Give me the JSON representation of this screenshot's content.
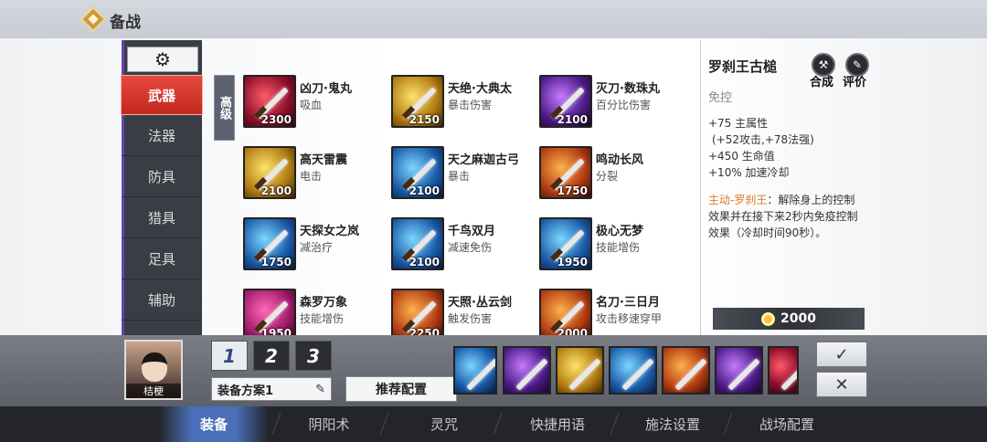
{
  "header": {
    "title": "备战"
  },
  "categories": [
    {
      "label": "武器",
      "active": true
    },
    {
      "label": "法器",
      "active": false
    },
    {
      "label": "防具",
      "active": false
    },
    {
      "label": "猎具",
      "active": false
    },
    {
      "label": "足具",
      "active": false
    },
    {
      "label": "辅助",
      "active": false
    }
  ],
  "tier_tab": "高级",
  "items": [
    {
      "name": "凶刀·鬼丸",
      "desc": "吸血",
      "price": "2300",
      "tone": "red"
    },
    {
      "name": "天绝·大典太",
      "desc": "暴击伤害",
      "price": "2150",
      "tone": "gold"
    },
    {
      "name": "灭刀·数珠丸",
      "desc": "百分比伤害",
      "price": "2100",
      "tone": "purple"
    },
    {
      "name": "高天雷震",
      "desc": "电击",
      "price": "2100",
      "tone": "gold"
    },
    {
      "name": "天之麻迦古弓",
      "desc": "暴击",
      "price": "2100",
      "tone": "blue"
    },
    {
      "name": "鸣动长风",
      "desc": "分裂",
      "price": "1750",
      "tone": "fire"
    },
    {
      "name": "天探女之岚",
      "desc": "减治疗",
      "price": "1750",
      "tone": "blue"
    },
    {
      "name": "千鸟双月",
      "desc": "减速免伤",
      "price": "2100",
      "tone": "blue"
    },
    {
      "name": "极心无梦",
      "desc": "技能增伤",
      "price": "1950",
      "tone": "blue"
    },
    {
      "name": "森罗万象",
      "desc": "技能增伤",
      "price": "1950",
      "tone": "pink"
    },
    {
      "name": "天照·丛云剑",
      "desc": "触发伤害",
      "price": "2250",
      "tone": "fire"
    },
    {
      "name": "名刀·三日月",
      "desc": "攻击移速穿甲",
      "price": "2000",
      "tone": "fire"
    }
  ],
  "detail": {
    "title": "罗刹王古槌",
    "subtitle": "免控",
    "stats": [
      "+75 主属性",
      "(+52攻击,+78法强)",
      "+450 生命值",
      "+10% 加速冷却"
    ],
    "skill_highlight": "主动-罗刹王",
    "skill_text": "：解除身上的控制效果并在接下来2秒内免疫控制效果（冷却时间90秒）。",
    "combine_label": "合成",
    "review_label": "评价",
    "cost": "2000"
  },
  "loadout": {
    "character_name": "桔梗",
    "plan_tabs": [
      "1",
      "2",
      "3"
    ],
    "active_plan": 0,
    "plan_name": "装备方案1",
    "recommend_label": "推荐配置",
    "confirm_icon": "✓",
    "cancel_icon": "✕",
    "slots": [
      "blue",
      "purple",
      "gold",
      "blue",
      "fire",
      "purple",
      "red"
    ]
  },
  "bottom_nav": [
    {
      "label": "装备",
      "active": true
    },
    {
      "label": "阴阳术",
      "active": false
    },
    {
      "label": "灵咒",
      "active": false
    },
    {
      "label": "快捷用语",
      "active": false
    },
    {
      "label": "施法设置",
      "active": false
    },
    {
      "label": "战场配置",
      "active": false
    }
  ],
  "icons": {
    "gear": "gear-icon",
    "coin": "coin-icon",
    "pen": "pen-icon"
  }
}
